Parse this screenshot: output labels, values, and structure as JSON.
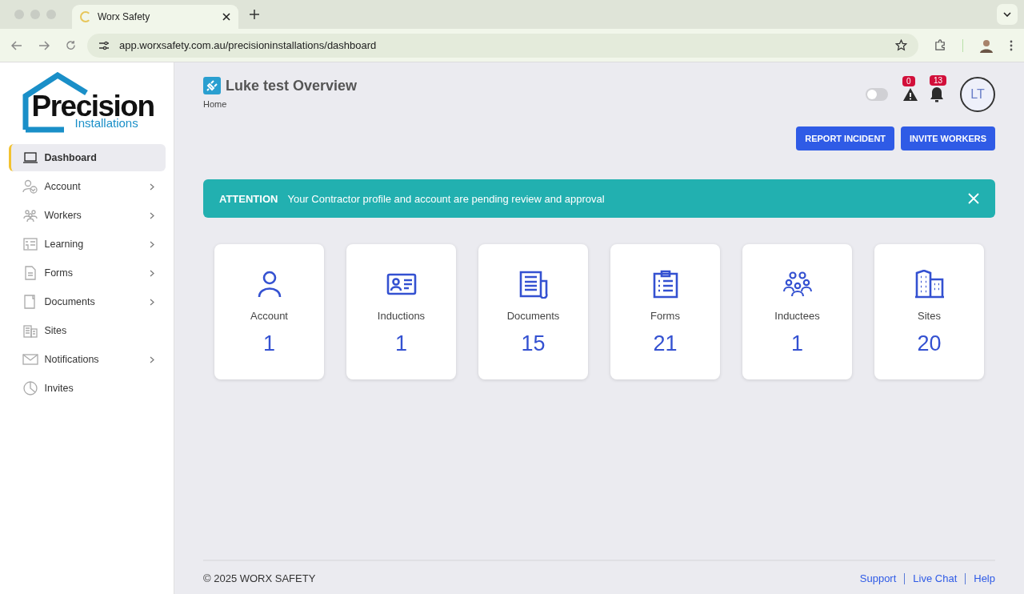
{
  "browser": {
    "tab_title": "Worx Safety",
    "url": "app.worxsafety.com.au/precisioninstallations/dashboard"
  },
  "logo": {
    "name": "Precision",
    "tagline": "Installations"
  },
  "sidebar": {
    "items": [
      {
        "kind": "laptop",
        "label": "Dashboard",
        "selected": true,
        "expandable": false
      },
      {
        "kind": "account",
        "label": "Account",
        "selected": false,
        "expandable": true
      },
      {
        "kind": "workers",
        "label": "Workers",
        "selected": false,
        "expandable": true
      },
      {
        "kind": "learning",
        "label": "Learning",
        "selected": false,
        "expandable": true
      },
      {
        "kind": "forms",
        "label": "Forms",
        "selected": false,
        "expandable": true
      },
      {
        "kind": "documents",
        "label": "Documents",
        "selected": false,
        "expandable": true
      },
      {
        "kind": "sites",
        "label": "Sites",
        "selected": false,
        "expandable": false
      },
      {
        "kind": "notifications",
        "label": "Notifications",
        "selected": false,
        "expandable": true
      },
      {
        "kind": "invites",
        "label": "Invites",
        "selected": false,
        "expandable": false
      }
    ]
  },
  "header": {
    "title": "Luke test Overview",
    "breadcrumb": "Home",
    "toggle_on": false,
    "alerts_count": "0",
    "notifications_count": "13",
    "avatar_initials": "LT",
    "buttons": [
      "REPORT INCIDENT",
      "INVITE WORKERS"
    ]
  },
  "alert": {
    "label": "ATTENTION",
    "message": "Your Contractor profile and account are pending review and approval"
  },
  "stats": [
    {
      "kind": "person",
      "label": "Account",
      "value": "1"
    },
    {
      "kind": "id-card",
      "label": "Inductions",
      "value": "1"
    },
    {
      "kind": "newspaper",
      "label": "Documents",
      "value": "15"
    },
    {
      "kind": "clipboard",
      "label": "Forms",
      "value": "21"
    },
    {
      "kind": "group",
      "label": "Inductees",
      "value": "1"
    },
    {
      "kind": "building",
      "label": "Sites",
      "value": "20"
    }
  ],
  "footer": {
    "copyright": "© 2025 WORX SAFETY",
    "links": [
      "Support",
      "Live Chat",
      "Help"
    ]
  }
}
